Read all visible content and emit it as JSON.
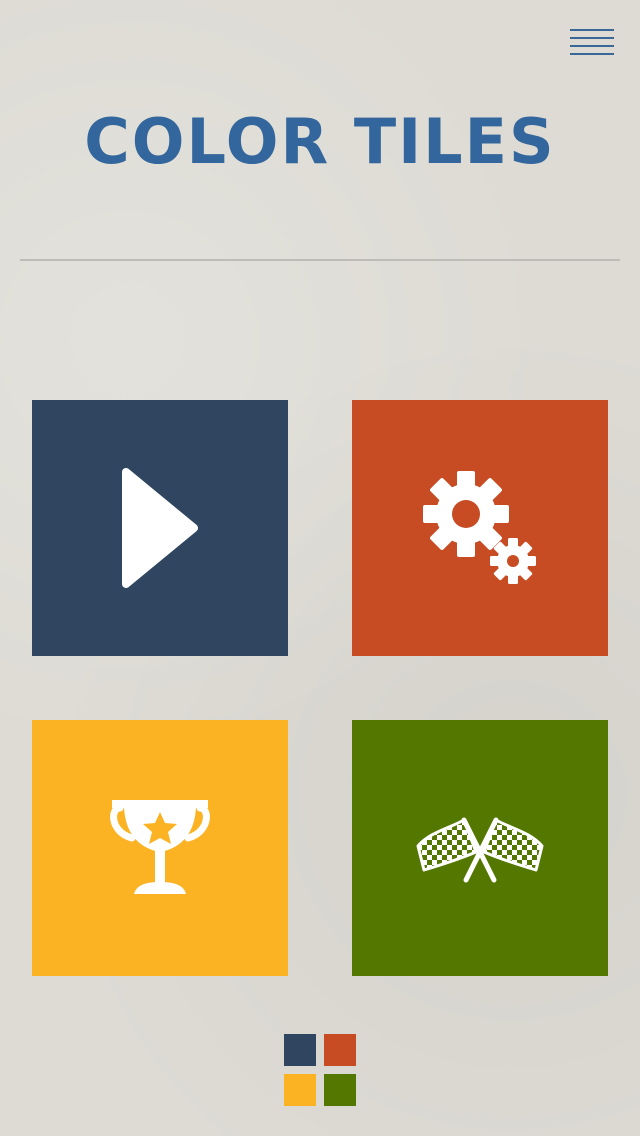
{
  "app": {
    "title": "COLOR TILES"
  },
  "colors": {
    "title": "#33669c",
    "menu_icon": "#3a6699",
    "play_tile": "#2f4560",
    "settings_tile": "#c74b23",
    "trophy_tile": "#fbb323",
    "race_tile": "#547700",
    "icon": "#ffffff",
    "background": "#dddbd4"
  },
  "tiles": [
    {
      "name": "play",
      "icon": "play-icon"
    },
    {
      "name": "settings",
      "icon": "gears-icon"
    },
    {
      "name": "achievements",
      "icon": "trophy-icon"
    },
    {
      "name": "race",
      "icon": "checkered-flags-icon"
    }
  ],
  "header": {
    "menu_icon": "hamburger-menu-icon"
  },
  "footer": {
    "logo_icon": "four-square-logo-icon"
  }
}
